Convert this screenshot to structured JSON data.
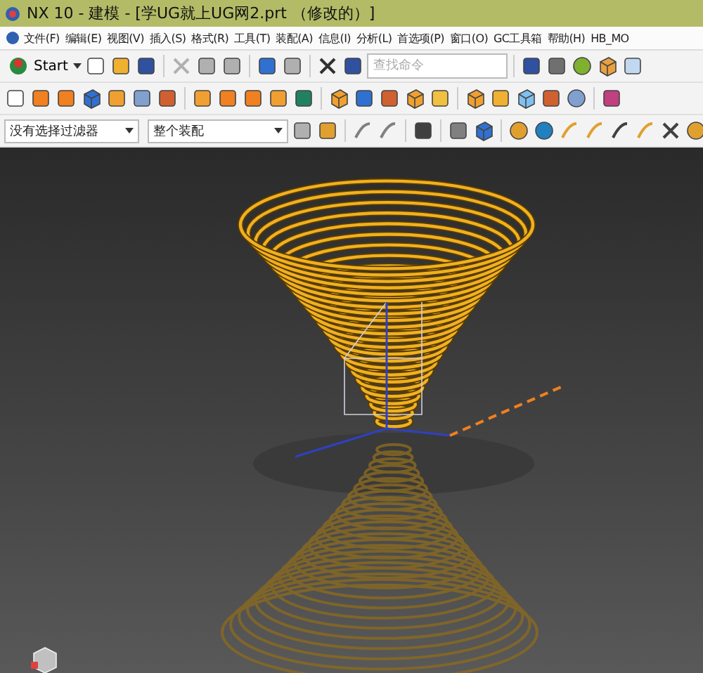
{
  "window": {
    "title": "NX 10 - 建模 - [学UG就上UG网2.prt （修改的）]"
  },
  "menu": [
    {
      "label": "文件(F)"
    },
    {
      "label": "编辑(E)"
    },
    {
      "label": "视图(V)"
    },
    {
      "label": "插入(S)"
    },
    {
      "label": "格式(R)"
    },
    {
      "label": "工具(T)"
    },
    {
      "label": "装配(A)"
    },
    {
      "label": "信息(I)"
    },
    {
      "label": "分析(L)"
    },
    {
      "label": "首选项(P)"
    },
    {
      "label": "窗口(O)"
    },
    {
      "label": "GC工具箱"
    },
    {
      "label": "帮助(H)"
    },
    {
      "label": "HB_MO"
    }
  ],
  "toolbar": {
    "start_label": "Start",
    "search": {
      "placeholder": "查找命令"
    }
  },
  "selection_bar": {
    "filter": "没有选择过滤器",
    "scope": "整个装配"
  }
}
